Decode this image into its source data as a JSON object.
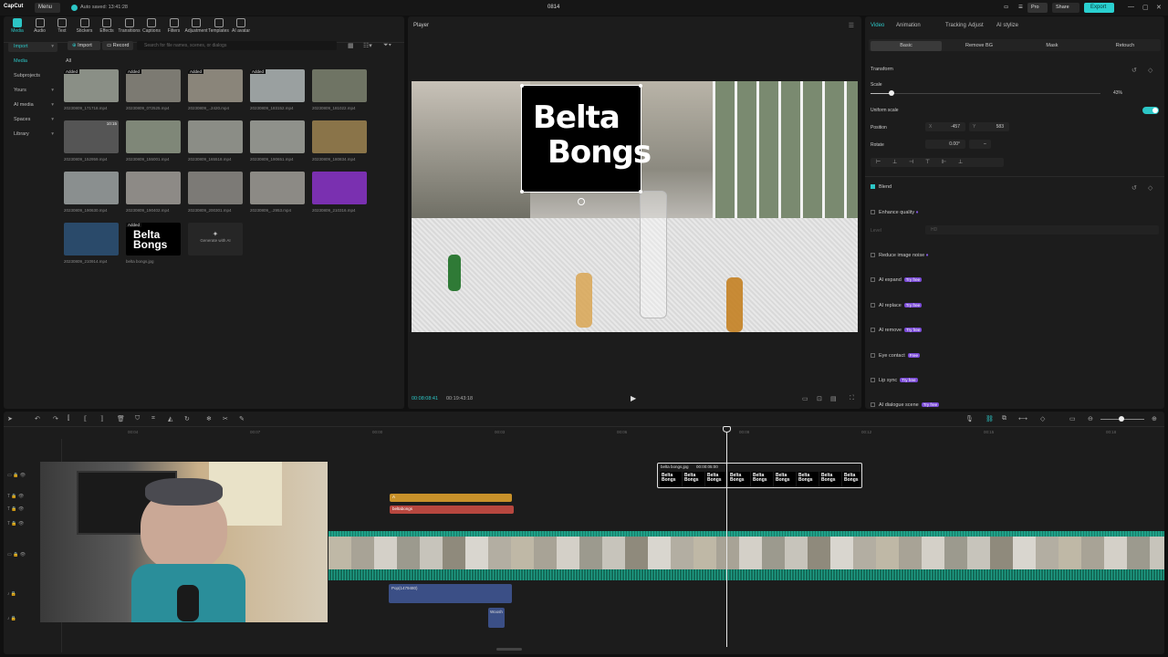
{
  "app": {
    "logo": "CapCut",
    "menu": "Menu",
    "autosave": "Auto saved: 13:41:28",
    "project_title": "0814",
    "pro_label": "Pro",
    "share_label": "Share",
    "export_label": "Export"
  },
  "toolbar": [
    {
      "label": "Media",
      "icon": "media-icon",
      "active": true
    },
    {
      "label": "Audio",
      "icon": "audio-icon"
    },
    {
      "label": "Text",
      "icon": "text-icon"
    },
    {
      "label": "Stickers",
      "icon": "stickers-icon"
    },
    {
      "label": "Effects",
      "icon": "effects-icon"
    },
    {
      "label": "Transitions",
      "icon": "transitions-icon"
    },
    {
      "label": "Captions",
      "icon": "captions-icon"
    },
    {
      "label": "Filters",
      "icon": "filters-icon"
    },
    {
      "label": "Adjustment",
      "icon": "adjustment-icon"
    },
    {
      "label": "Templates",
      "icon": "templates-icon"
    },
    {
      "label": "AI avatar",
      "icon": "ai-avatar-icon"
    }
  ],
  "sidebar": [
    "Import",
    "Media",
    "Subprojects",
    "Yours",
    "AI media",
    "Spaces",
    "Library"
  ],
  "media": {
    "import_label": "Import",
    "record_label": "Record",
    "search_placeholder": "Search for file names, scenes, or dialogs",
    "filter_all": "All",
    "generate_label": "Generate with AI",
    "items": [
      {
        "name": "20230809_171718.mp4",
        "added": "Added",
        "c": "#8a8f86"
      },
      {
        "name": "20230809_072525.mp4",
        "added": "Added",
        "c": "#7c7a72"
      },
      {
        "name": "20230809_..2420.mp4",
        "added": "Added",
        "c": "#8a857a"
      },
      {
        "name": "20230809_183152.mp4",
        "added": "Added",
        "c": "#9aa0a0"
      },
      {
        "name": "20230809_181022.mp4",
        "added": "",
        "c": "#6f7464"
      },
      {
        "name": "20230809_152959.mp4",
        "added": "",
        "c": "#555555",
        "dur": "10:15"
      },
      {
        "name": "20230809_155001.mp4",
        "added": "",
        "c": "#7f8778"
      },
      {
        "name": "20230809_165518.mp4",
        "added": "",
        "c": "#8b8d86"
      },
      {
        "name": "20230809_190651.mp4",
        "added": "",
        "c": "#8f918b"
      },
      {
        "name": "20230809_180834.mp4",
        "added": "",
        "c": "#8a7449"
      },
      {
        "name": "20230809_190630.mp4",
        "added": "",
        "c": "#8a8f8f"
      },
      {
        "name": "20230809_190402.mp4",
        "added": "",
        "c": "#8d8a86"
      },
      {
        "name": "20230809_200301.mp4",
        "added": "",
        "c": "#7c7a76"
      },
      {
        "name": "20230809_..2953.mp4",
        "added": "",
        "c": "#8c8a85"
      },
      {
        "name": "20230809_210316.mp4",
        "added": "",
        "c": "#7a30b0"
      },
      {
        "name": "20230809_210914.mp4",
        "added": "",
        "c": "#2a4a6a"
      },
      {
        "name": "belta bongs.jpg",
        "added": "Added",
        "c": "#000000"
      }
    ]
  },
  "player": {
    "title": "Player",
    "time_current": "00:08:08:41",
    "time_total": "00:19:43:18",
    "overlay_line1": "Belta",
    "overlay_line2": "Bongs"
  },
  "props": {
    "tabs": [
      "Video",
      "Animation",
      "Tracking",
      "Adjust",
      "AI stylize"
    ],
    "subtabs": [
      "Basic",
      "Remove BG",
      "Mask",
      "Retouch"
    ],
    "transform": "Transform",
    "scale_label": "Scale",
    "scale_value": "43%",
    "uniform_scale": "Uniform scale",
    "position_label": "Position",
    "pos_x_label": "X",
    "pos_x": "-457",
    "pos_y_label": "Y",
    "pos_y": "583",
    "rotate_label": "Rotate",
    "rotate_value": "0.00°",
    "rotate_dash": "–",
    "blend": "Blend",
    "enhance": "Enhance quality",
    "level_label": "Level",
    "level_value": "HD",
    "reduce_noise": "Reduce image noise",
    "ai_expand": "AI expand",
    "ai_replace": "AI replace",
    "ai_remove": "AI remove",
    "eye_contact": "Eye contact",
    "lip_sync": "Lip sync",
    "ai_dialogue": "AI dialogue scene",
    "try_free": "Try free",
    "free": "Free"
  },
  "timeline": {
    "ruler": [
      "00:04",
      "00:07",
      "00:00",
      "00:03",
      "00:06",
      "00:09",
      "00:12",
      "00:15",
      "00:18"
    ],
    "clip_image": "belta bongs.jpg",
    "clip_image_dur": "00:00:05:00",
    "clip_text1": "A",
    "clip_text2": "beltabongs",
    "clip_audio1": "Pop(1479480)",
    "clip_audio2": "Woosh",
    "clip_image_text": "Belta Bongs"
  },
  "colors": {
    "accent": "#2cc6c6",
    "text_clip": "#c8912a",
    "text_clip2": "#b7473f",
    "audio_clip": "#3b4f86",
    "main_track": "#1fa088"
  }
}
